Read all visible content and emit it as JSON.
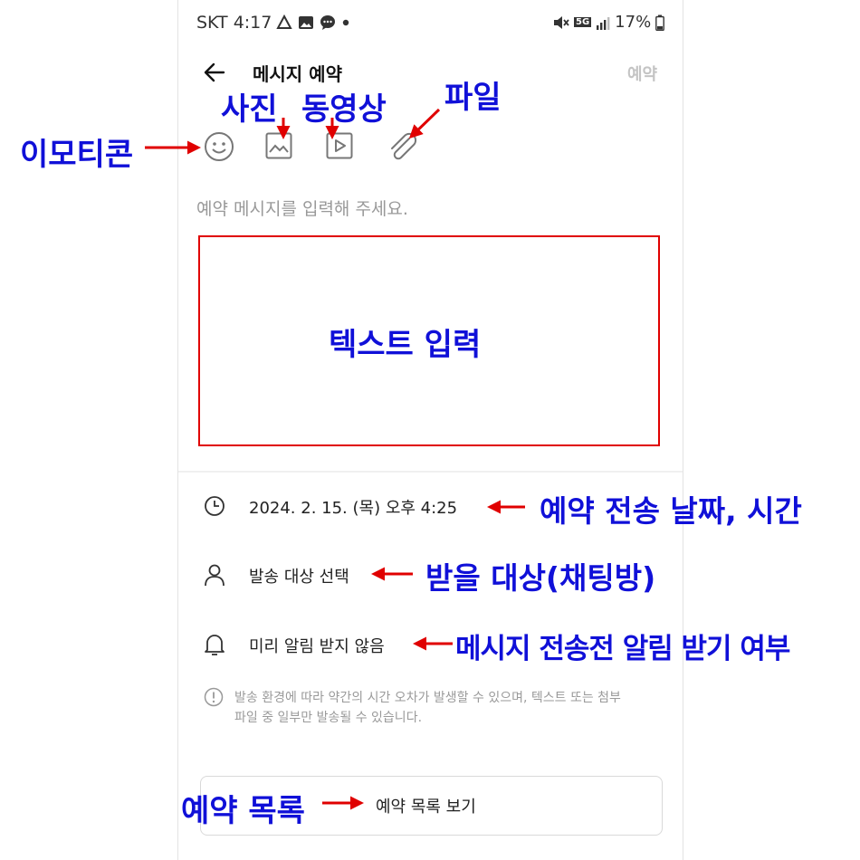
{
  "status_bar": {
    "carrier_time": "SKT 4:17",
    "network": "5G",
    "battery": "17%",
    "icons": [
      "drive-icon",
      "gallery-icon",
      "chat-icon",
      "dot-icon",
      "mute-icon",
      "signal-icon",
      "battery-icon"
    ]
  },
  "header": {
    "back_icon": "arrow-left-icon",
    "title": "메시지 예약",
    "action_label": "예약"
  },
  "toolbar": {
    "icons": [
      "emoticon-icon",
      "photo-icon",
      "video-icon",
      "paperclip-icon"
    ]
  },
  "message_input": {
    "placeholder": "예약 메시지를 입력해 주세요."
  },
  "settings": {
    "datetime": "2024. 2. 15. (목) 오후 4:25",
    "recipient": "발송 대상 선택",
    "notification": "미리 알림 받지 않음",
    "icons": [
      "clock-icon",
      "person-icon",
      "bell-icon"
    ]
  },
  "notice": {
    "line1": "발송 환경에 따라 약간의 시간 오차가 발생할 수 있으며, 텍스트 또는 첨부",
    "line2": "파일 중 일부만 발송될 수 있습니다.",
    "icon": "info-icon"
  },
  "list_button": {
    "label": "예약 목록 보기"
  },
  "annotations": {
    "emoticon": "이모티콘",
    "photo": "사진",
    "video": "동영상",
    "file": "파일",
    "text_input": "텍스트 입력",
    "datetime": "예약 전송 날짜, 시간",
    "recipient": "받을 대상(채팅방)",
    "notification": "메시지 전송전 알림 받기 여부",
    "list": "예약 목록"
  },
  "colors": {
    "annotation_text": "#1010d8",
    "annotation_arrow": "#e00000",
    "highlight_box": "#e00000"
  }
}
